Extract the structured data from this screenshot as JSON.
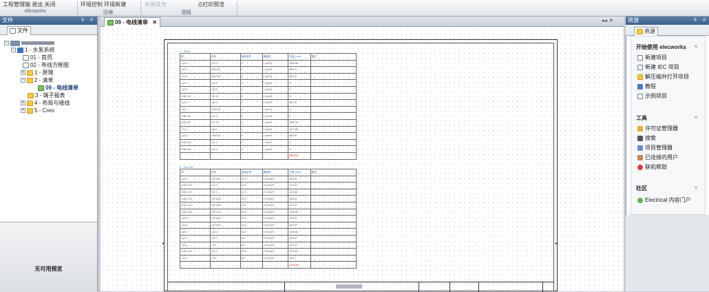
{
  "ribbon": {
    "btn1": "工程管理端 退出 关闭",
    "btn2": "环境控制 环境新建",
    "btn_save_as": "另存为",
    "btn_print_preview": "打印预览",
    "group1": "elecworks",
    "group2": "压缩",
    "group3": "图纸"
  },
  "left_panel": {
    "title": "文件",
    "pin": "ǂ",
    "close": "✕",
    "tab": "文件",
    "tree": [
      {
        "label": "1 - 水泵系统"
      },
      {
        "label": "01 - 首页"
      },
      {
        "label": "02 - 布线方框图"
      },
      {
        "label": "1 - 原理"
      },
      {
        "label": "2 - 清单"
      },
      {
        "label": "09 - 电线清单"
      },
      {
        "label": "3 - 端子报表"
      },
      {
        "label": "4 - 布局与接线"
      },
      {
        "label": "5 - Creo"
      }
    ],
    "preview_text": "无可用预览"
  },
  "document": {
    "tab_label": "09 - 电线清单",
    "tab_close": "✕",
    "nav": "◂ ▸ ✕"
  },
  "table1": {
    "title": "1 - 200V",
    "headers": [
      "源",
      "目标",
      "电缆名称",
      "截面积",
      "长度 (mm)",
      "备注"
    ],
    "rows": [
      [
        "-Q1.4",
        "-Q2.4",
        "1",
        "1 (mm²)",
        "1228.88",
        ""
      ],
      [
        "-Q2.4",
        "-KM1.62",
        "1",
        "1 (mm²)",
        "380.12",
        ""
      ],
      [
        "-Q1.3",
        "-KM1.62",
        "1",
        "1 (mm²)",
        "553.11",
        ""
      ],
      [
        "-Q1.2",
        "-Q2.2",
        "1",
        "1 (mm²)",
        "0",
        ""
      ],
      [
        "-Q2.6",
        "-Q2.6",
        "1",
        "1 (mm²)",
        "0",
        ""
      ],
      [
        "-KM1.1/2",
        "-X1.11",
        "1",
        "1 (mm²)",
        "0",
        ""
      ],
      [
        "-Q2.5",
        "-Q2.1",
        "1",
        "1 (mm²)",
        "382.23",
        ""
      ],
      [
        "-Q1.1",
        "-KM1.32",
        "1",
        "1 (mm²)",
        "0",
        ""
      ],
      [
        "-KM1.52",
        "-Q1.4",
        "1",
        "1 (mm²)",
        "0",
        ""
      ],
      [
        "-KM1.82",
        "-X1.32",
        "1",
        "1 (mm²)",
        "1095.76",
        ""
      ],
      [
        "-Y1.2",
        "-Q2.1",
        "1",
        "1 (mm²)",
        "1177.88",
        ""
      ],
      [
        "-Q1.4",
        "-KM1.31",
        "1",
        "1 (mm²)",
        "998.32",
        ""
      ],
      [
        "-KM1.6/1",
        "-X1.1",
        "1",
        "1 (mm²)",
        "0",
        ""
      ],
      [
        "-KM1.6/1",
        "-X1.2",
        "1",
        "1 (mm²)",
        "0",
        ""
      ]
    ],
    "total": "6553.09"
  },
  "table2": {
    "title": "2 - 24V DC",
    "headers": [
      "源",
      "目标",
      "电缆名称",
      "截面积",
      "长度 (mm)",
      "备注"
    ],
    "rows": [
      [
        "-Q2.4",
        "-QF1/2/2",
        "12.5",
        "2.5 (mm²)",
        "226.31",
        ""
      ],
      [
        "-KM1.1/71",
        "-X1.1",
        "12.5",
        "2.5 (mm²)",
        "213.25",
        ""
      ],
      [
        "-KM1.1/71",
        "-X1.1",
        "12.5",
        "2.5 (mm²)",
        "-223.61",
        ""
      ],
      [
        "-KM1.1/11",
        "-QF1/2/2",
        "12.5",
        "2.5 (mm²)",
        "528.02",
        ""
      ],
      [
        "-KM1.1/12",
        "-QF1/2/2",
        "12.5",
        "2.5 (mm²)",
        "512.22",
        ""
      ],
      [
        "-KM1.1/11",
        "-QF1.1/1",
        "12.5",
        "2.5 (mm²)",
        "-328.95",
        ""
      ],
      [
        "-Q2.8",
        "-QF1/2/2",
        "12.5",
        "2.5 (mm²)",
        "328.25",
        ""
      ],
      [
        "-Q2.8",
        "-QF1/2/2",
        "12.5",
        "2.5 (mm²)",
        "309.22",
        ""
      ],
      [
        "-Q2.2",
        "-Q2.2",
        "12.2",
        "2.5 (mm²)",
        "-283.06",
        ""
      ],
      [
        "-Q2.4",
        "-Q2.1",
        "8.5",
        "2.5 (mm²)",
        "248.10",
        ""
      ],
      [
        "-Q2.4",
        "-T11",
        "8.5",
        "2.5 (mm²)",
        "225.22",
        ""
      ],
      [
        "-KM1.1/71",
        "-X1.1",
        "12.5",
        "2.5 (mm²)",
        "-223.61",
        ""
      ],
      [
        "-Q2.4",
        "-T11",
        "8.5",
        "2.5 (mm²)",
        "261.2",
        ""
      ]
    ],
    "total": "2229.36"
  },
  "right_panel": {
    "title": "资源",
    "pin": "ǂ",
    "close": "✕",
    "tab": "资源",
    "sections": {
      "start": {
        "heading": "开始使用 elecworks",
        "links": [
          "新建项目",
          "新建 IEC 项目",
          "解压缩并打开项目",
          "教程",
          "示例项目"
        ]
      },
      "tools": {
        "heading": "工具",
        "links": [
          "许可证管理器",
          "搜索",
          "项目管理器",
          "已连接的用户",
          "联机帮助"
        ]
      },
      "community": {
        "heading": "社区",
        "links": [
          "Electrical 内容门户"
        ]
      }
    }
  }
}
